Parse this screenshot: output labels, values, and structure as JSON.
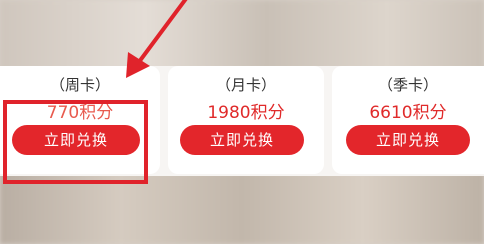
{
  "cards": [
    {
      "tier": "（周卡）",
      "points": "770积分",
      "button": "立即兑换"
    },
    {
      "tier": "（月卡）",
      "points": "1980积分",
      "button": "立即兑换"
    },
    {
      "tier": "（季卡）",
      "points": "6610积分",
      "button": "立即兑换"
    }
  ],
  "colors": {
    "accent": "#e3262b",
    "annotation": "#e0232b"
  },
  "annotation": {
    "shape": "rectangle-and-arrow",
    "target": "card-week-redeem"
  }
}
